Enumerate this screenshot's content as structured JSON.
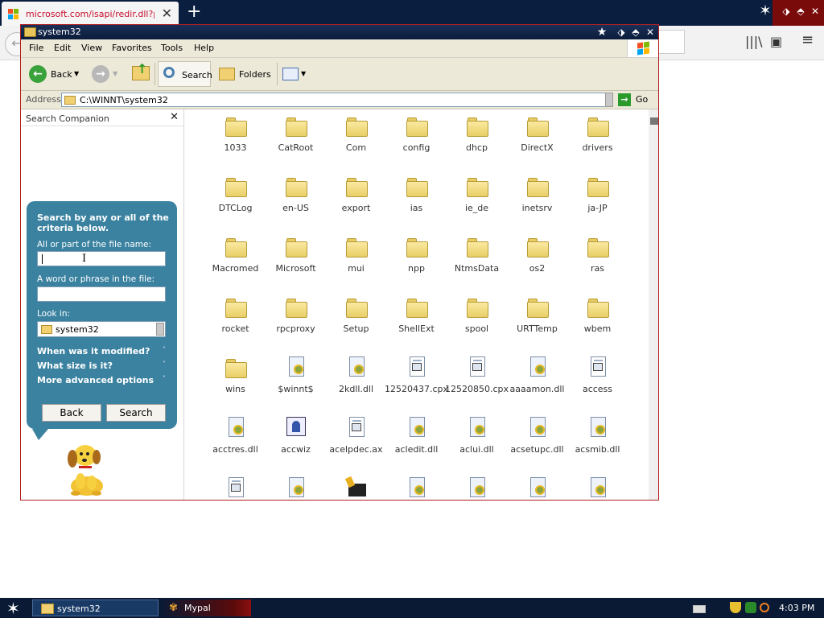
{
  "browser": {
    "tab_title": "microsoft.com/isapi/redir.dll?prd=",
    "tab_close": "✕",
    "new_tab": "+",
    "back": "←",
    "library_icon": "|||\\",
    "sidebar_icon": "▣",
    "menu_icon": "≡",
    "colors": {
      "chrome": "#0a1f3f",
      "accent": "#7a0b0b"
    }
  },
  "window": {
    "title": "system32",
    "controls": [
      "★",
      "⬗",
      "⬘",
      "✕"
    ]
  },
  "menu": [
    "File",
    "Edit",
    "View",
    "Favorites",
    "Tools",
    "Help"
  ],
  "toolbar": {
    "back": "Back",
    "search": "Search",
    "folders": "Folders"
  },
  "address": {
    "label": "Address",
    "value": "C:\\WINNT\\system32",
    "go": "Go"
  },
  "search_pane": {
    "header": "Search Companion",
    "close": "✕",
    "title": "Search by any or all of the criteria below.",
    "filename_label": "All or part of the file name:",
    "filename_value": "",
    "phrase_label": "A word or phrase in the file:",
    "phrase_value": "",
    "lookin_label": "Look in:",
    "lookin_value": "system32",
    "opt_modified": "When was it modified?",
    "opt_size": "What size is it?",
    "opt_advanced": "More advanced options",
    "chevron": "˅",
    "back_button": "Back",
    "search_button": "Search"
  },
  "files": [
    {
      "name": "1033",
      "type": "folder"
    },
    {
      "name": "CatRoot",
      "type": "folder"
    },
    {
      "name": "Com",
      "type": "folder"
    },
    {
      "name": "config",
      "type": "folder"
    },
    {
      "name": "dhcp",
      "type": "folder"
    },
    {
      "name": "DirectX",
      "type": "folder"
    },
    {
      "name": "drivers",
      "type": "folder"
    },
    {
      "name": "DTCLog",
      "type": "folder"
    },
    {
      "name": "en-US",
      "type": "folder"
    },
    {
      "name": "export",
      "type": "folder"
    },
    {
      "name": "ias",
      "type": "folder"
    },
    {
      "name": "ie_de",
      "type": "folder"
    },
    {
      "name": "inetsrv",
      "type": "folder"
    },
    {
      "name": "ja-JP",
      "type": "folder"
    },
    {
      "name": "Macromed",
      "type": "folder"
    },
    {
      "name": "Microsoft",
      "type": "folder"
    },
    {
      "name": "mui",
      "type": "folder"
    },
    {
      "name": "npp",
      "type": "folder"
    },
    {
      "name": "NtmsData",
      "type": "folder"
    },
    {
      "name": "os2",
      "type": "folder"
    },
    {
      "name": "ras",
      "type": "folder"
    },
    {
      "name": "rocket",
      "type": "folder"
    },
    {
      "name": "rpcproxy",
      "type": "folder"
    },
    {
      "name": "Setup",
      "type": "folder"
    },
    {
      "name": "ShellExt",
      "type": "folder"
    },
    {
      "name": "spool",
      "type": "folder"
    },
    {
      "name": "URTTemp",
      "type": "folder"
    },
    {
      "name": "wbem",
      "type": "folder"
    },
    {
      "name": "wins",
      "type": "folder"
    },
    {
      "name": "$winnt$",
      "type": "dll"
    },
    {
      "name": "2kdll.dll",
      "type": "dll"
    },
    {
      "name": "12520437.cpx",
      "type": "doc"
    },
    {
      "name": "12520850.cpx",
      "type": "doc"
    },
    {
      "name": "aaaamon.dll",
      "type": "dll"
    },
    {
      "name": "access",
      "type": "doc"
    },
    {
      "name": "acctres.dll",
      "type": "dll"
    },
    {
      "name": "accwiz",
      "type": "wiz"
    },
    {
      "name": "acelpdec.ax",
      "type": "doc"
    },
    {
      "name": "acledit.dll",
      "type": "dll"
    },
    {
      "name": "aclui.dll",
      "type": "dll"
    },
    {
      "name": "acsetupc.dll",
      "type": "dll"
    },
    {
      "name": "acsmib.dll",
      "type": "dll"
    },
    {
      "name": "",
      "type": "doc"
    },
    {
      "name": "",
      "type": "dll"
    },
    {
      "name": "",
      "type": "app"
    },
    {
      "name": "",
      "type": "dll"
    },
    {
      "name": "",
      "type": "dll"
    },
    {
      "name": "",
      "type": "dll"
    },
    {
      "name": "",
      "type": "dll"
    }
  ],
  "taskbar": {
    "start": "✶",
    "tasks": [
      "system32",
      "Mypal"
    ],
    "time": "4:03 PM"
  }
}
